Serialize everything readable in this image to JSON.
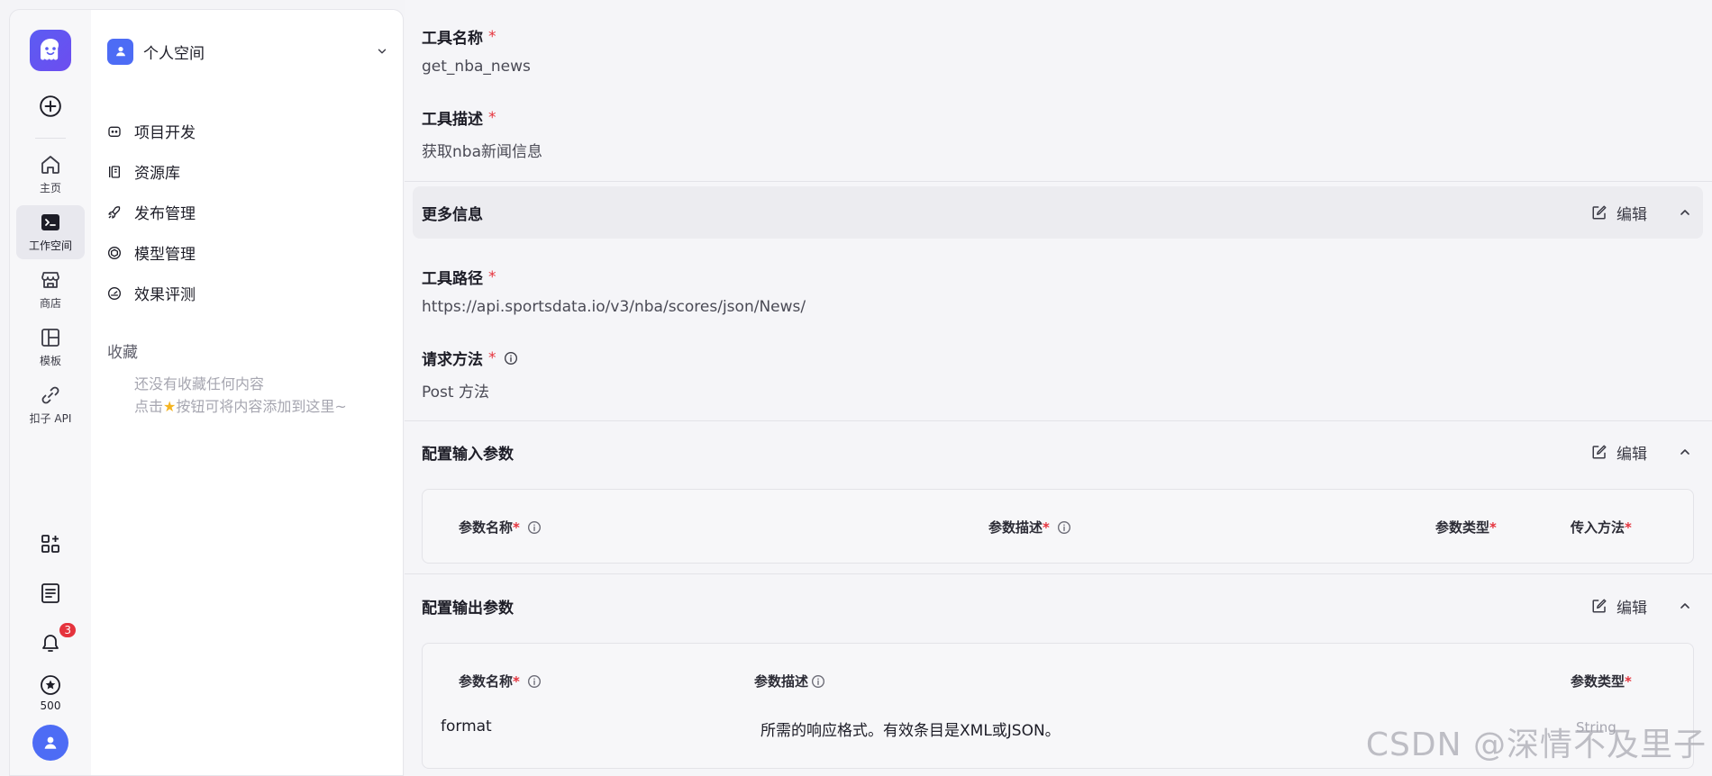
{
  "rail": {
    "items": [
      {
        "label": "主页",
        "icon": "home-icon"
      },
      {
        "label": "工作空间",
        "icon": "terminal-icon"
      },
      {
        "label": "商店",
        "icon": "store-icon"
      },
      {
        "label": "模板",
        "icon": "template-icon"
      },
      {
        "label": "扣子 API",
        "icon": "link-icon"
      }
    ],
    "notification_count": "3",
    "points": "500"
  },
  "sidebar": {
    "space_name": "个人空间",
    "nav": [
      {
        "label": "项目开发",
        "icon": "robot-icon"
      },
      {
        "label": "资源库",
        "icon": "library-icon"
      },
      {
        "label": "发布管理",
        "icon": "rocket-icon"
      },
      {
        "label": "模型管理",
        "icon": "cube-icon"
      },
      {
        "label": "效果评测",
        "icon": "gauge-icon"
      }
    ],
    "favorites_title": "收藏",
    "favorites_empty_line1": "还没有收藏任何内容",
    "favorites_empty_prefix": "点击",
    "favorites_empty_suffix": "按钮可将内容添加到这里~"
  },
  "main": {
    "tool_name_label": "工具名称",
    "tool_name_value": "get_nba_news",
    "tool_desc_label": "工具描述",
    "tool_desc_value": "获取nba新闻信息",
    "more_info_title": "更多信息",
    "edit_label": "编辑",
    "tool_path_label": "工具路径",
    "tool_path_value": "https://api.sportsdata.io/v3/nba/scores/json/News/",
    "method_label": "请求方法",
    "method_value": "Post 方法",
    "input_section_title": "配置输入参数",
    "input_columns": [
      "参数名称",
      "参数描述",
      "参数类型",
      "传入方法"
    ],
    "output_section_title": "配置输出参数",
    "output_columns": [
      "参数名称",
      "参数描述",
      "参数类型"
    ],
    "output_rows": [
      {
        "name": "format",
        "desc": "所需的响应格式。有效条目是XML或JSON。",
        "type": "String"
      }
    ],
    "required_mark": "*"
  },
  "watermark": "CSDN @深情不及里子"
}
